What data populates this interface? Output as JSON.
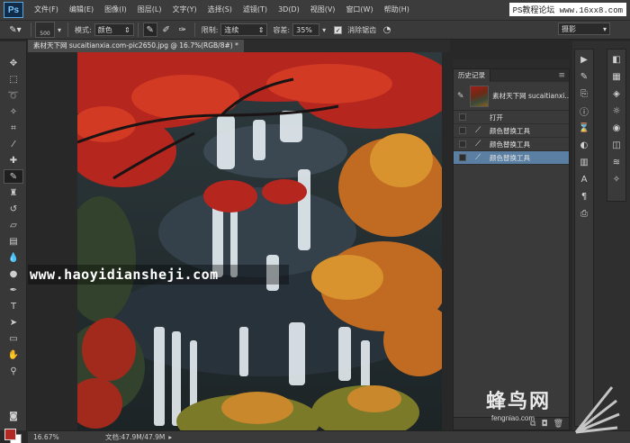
{
  "app": {
    "logo": "Ps"
  },
  "menu": [
    "文件(F)",
    "编辑(E)",
    "图像(I)",
    "图层(L)",
    "文字(Y)",
    "选择(S)",
    "滤镜(T)",
    "3D(D)",
    "视图(V)",
    "窗口(W)",
    "帮助(H)"
  ],
  "watermark_top": "PS教程论坛 www.16xx8.com",
  "options": {
    "brush_size": "500",
    "mode_label": "模式:",
    "mode_value": "颜色",
    "limit_label": "限制:",
    "limit_value": "连续",
    "tolerance_label": "容差:",
    "tolerance_value": "35%",
    "antialias_label": "消除锯齿",
    "antialias_checked": true,
    "workspace": "摄影"
  },
  "document": {
    "tab": "素材天下网 sucaitianxia.com-pic2650.jpg @ 16.7%(RGB/8#) *",
    "zoom": "16.67%",
    "docsize": "文档:47.9M/47.9M"
  },
  "overlay_url": "www.haoyidiansheji.com",
  "history": {
    "tab": "历史记录",
    "snapshot_label": "素材天下网 sucaitianxi...",
    "items": [
      {
        "label": "打开",
        "icon": "document-icon",
        "selected": false
      },
      {
        "label": "颜色替换工具",
        "icon": "brush-icon",
        "selected": false
      },
      {
        "label": "颜色替换工具",
        "icon": "brush-icon",
        "selected": false
      },
      {
        "label": "颜色替换工具",
        "icon": "brush-icon",
        "selected": true
      }
    ]
  },
  "colors": {
    "foreground": "#b22a26",
    "background": "#ffffff",
    "selection": "#5a7fa3"
  },
  "brand_watermark": {
    "title": "蜂鸟网",
    "sub": "fengniao.com"
  }
}
